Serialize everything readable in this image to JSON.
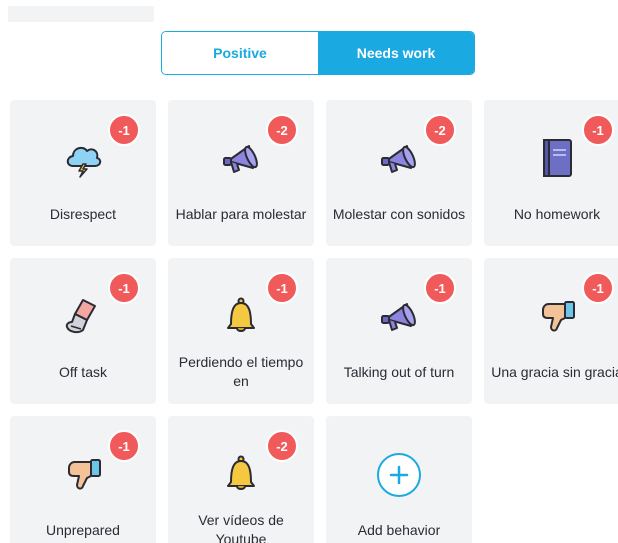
{
  "tabs": {
    "positive": "Positive",
    "needs_work": "Needs work",
    "selected": "needs_work"
  },
  "colors": {
    "accent": "#1aa9e0",
    "badge": "#f05a5b",
    "card": "#f2f3f5"
  },
  "behaviors": [
    {
      "label": "Disrespect",
      "points": "-1",
      "icon": "storm-cloud-icon"
    },
    {
      "label": "Hablar para molestar",
      "points": "-2",
      "icon": "megaphone-icon"
    },
    {
      "label": "Molestar con sonidos",
      "points": "-2",
      "icon": "megaphone-icon"
    },
    {
      "label": "No homework",
      "points": "-1",
      "icon": "notebook-icon"
    },
    {
      "label": "Off task",
      "points": "-1",
      "icon": "boot-icon"
    },
    {
      "label": "Perdiendo el tiempo en",
      "points": "-1",
      "icon": "bell-icon"
    },
    {
      "label": "Talking out of turn",
      "points": "-1",
      "icon": "megaphone-icon"
    },
    {
      "label": "Una gracia sin gracia",
      "points": "-1",
      "icon": "thumbs-down-icon"
    },
    {
      "label": "Unprepared",
      "points": "-1",
      "icon": "thumbs-down-icon"
    },
    {
      "label": "Ver vídeos de Youtube",
      "points": "-2",
      "icon": "bell-icon"
    }
  ],
  "add_behavior": {
    "label": "Add behavior",
    "icon": "plus-circle-icon"
  }
}
